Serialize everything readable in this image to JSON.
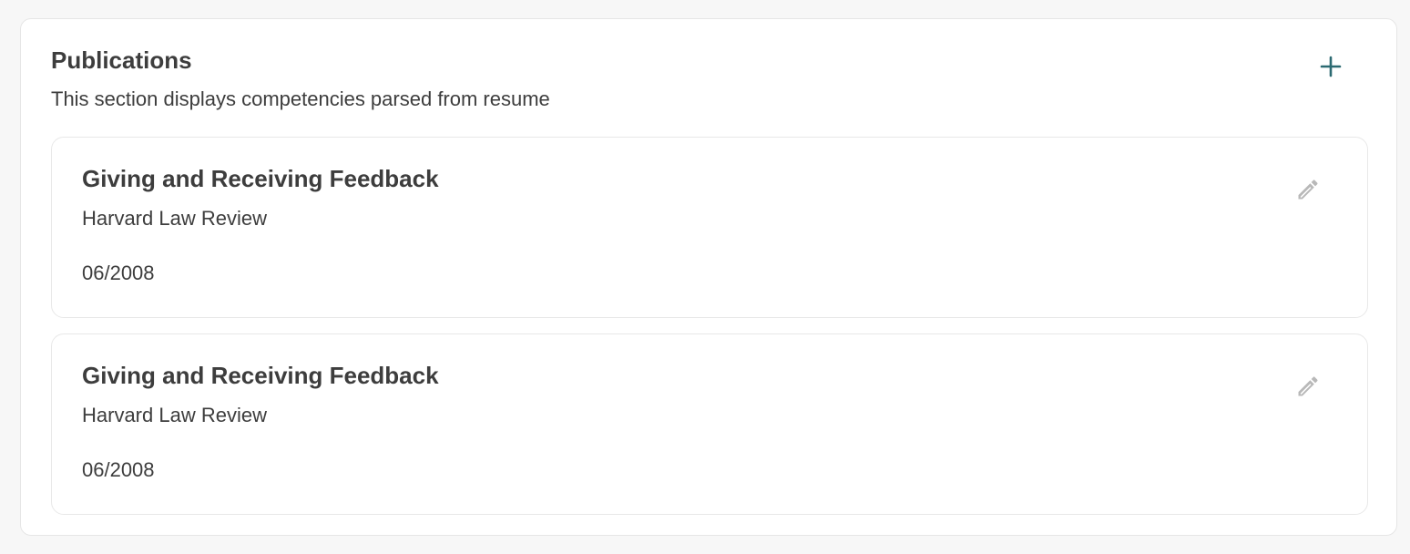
{
  "section": {
    "title": "Publications",
    "subtitle": "This section displays competencies parsed from resume",
    "add_icon": "plus-icon",
    "accent_color": "#2c6a72"
  },
  "publications": [
    {
      "title": "Giving and Receiving Feedback",
      "publisher": "Harvard Law Review",
      "date": "06/2008",
      "edit_icon": "pencil-icon"
    },
    {
      "title": "Giving and Receiving Feedback",
      "publisher": "Harvard Law Review",
      "date": "06/2008",
      "edit_icon": "pencil-icon"
    }
  ]
}
